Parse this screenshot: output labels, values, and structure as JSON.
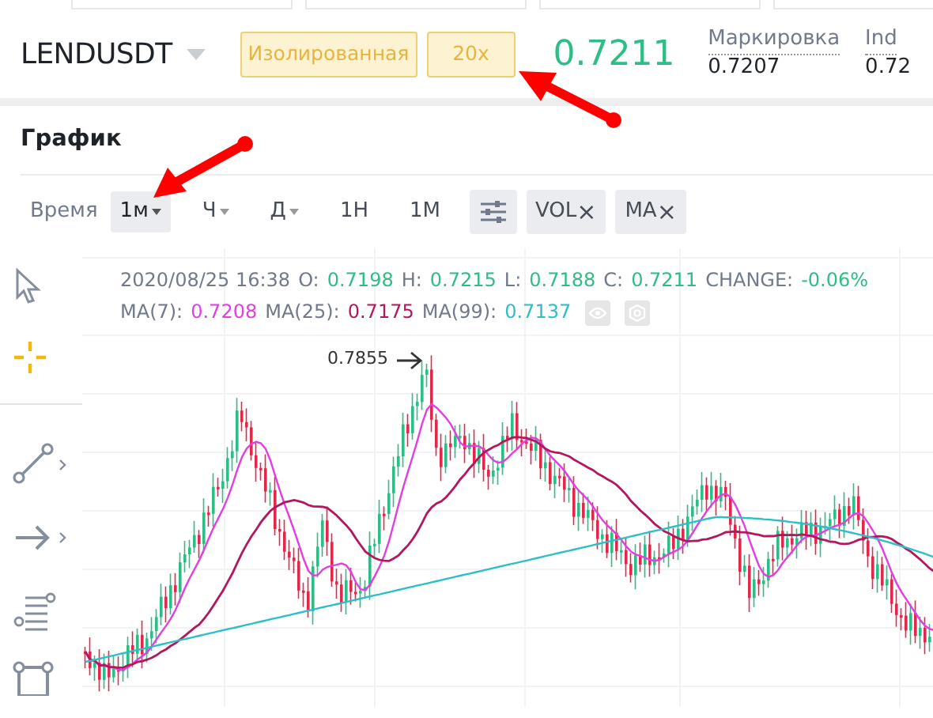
{
  "header": {
    "symbol": "LENDUSDT",
    "margin_mode": "Изолированная",
    "leverage": "20x",
    "last_price": "0.7211",
    "stats": [
      {
        "label": "Маркировка",
        "value": "0.7207"
      },
      {
        "label": "Ind",
        "value": "0.72"
      }
    ]
  },
  "section_title": "График",
  "toolbar": {
    "label": "Время",
    "intervals": [
      {
        "label": "1м",
        "dropdown": true,
        "selected": true
      },
      {
        "label": "Ч",
        "dropdown": true,
        "selected": false
      },
      {
        "label": "Д",
        "dropdown": true,
        "selected": false
      },
      {
        "label": "1Н",
        "dropdown": false,
        "selected": false
      },
      {
        "label": "1М",
        "dropdown": false,
        "selected": false
      }
    ],
    "indicators": [
      {
        "label": "VOL",
        "remove": "×"
      },
      {
        "label": "MA",
        "remove": "×"
      }
    ]
  },
  "chart": {
    "timestamp": "2020/08/25 16:38",
    "ohlc": [
      {
        "label": "O:",
        "value": "0.7198",
        "color": "#2ebd85"
      },
      {
        "label": "H:",
        "value": "0.7215",
        "color": "#2ebd85"
      },
      {
        "label": "L:",
        "value": "0.7188",
        "color": "#2ebd85"
      },
      {
        "label": "C:",
        "value": "0.7211",
        "color": "#2ebd85"
      },
      {
        "label": "CHANGE:",
        "value": "-0.06%",
        "color": "#2ebd85"
      }
    ],
    "ma": [
      {
        "label": "MA(7):",
        "value": "0.7208",
        "color": "#e33ee0"
      },
      {
        "label": "MA(25):",
        "value": "0.7175",
        "color": "#b3185e"
      },
      {
        "label": "MA(99):",
        "value": "0.7137",
        "color": "#2bbfc8"
      }
    ],
    "peak_label": "0.7855"
  }
}
